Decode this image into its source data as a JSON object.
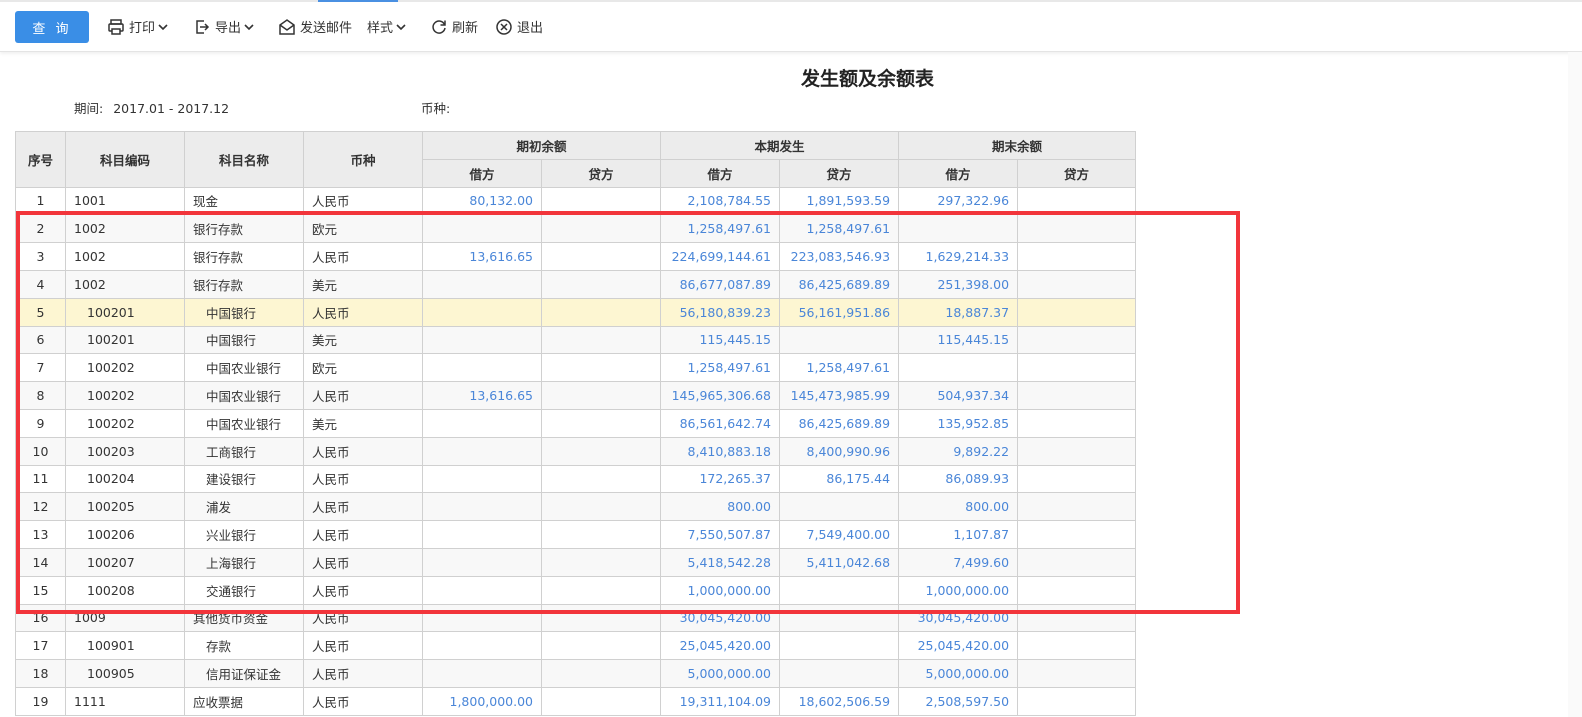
{
  "toolbar": {
    "query": "查 询",
    "print": "打印",
    "export": "导出",
    "email": "发送邮件",
    "style": "样式",
    "refresh": "刷新",
    "exit": "退出"
  },
  "report": {
    "title": "发生额及余额表",
    "period_label": "期间:",
    "period_value": "2017.01 - 2017.12",
    "currency_label": "币种:"
  },
  "table": {
    "headers": {
      "seq": "序号",
      "code": "科目编码",
      "name": "科目名称",
      "currency": "币种",
      "opening": "期初余额",
      "current": "本期发生",
      "closing": "期末余额",
      "debit": "借方",
      "credit": "贷方"
    },
    "rows": [
      {
        "seq": "1",
        "code": "1001",
        "name": "现金",
        "cur": "人民币",
        "ob_d": "80,132.00",
        "ob_c": "",
        "cp_d": "2,108,784.55",
        "cp_c": "1,891,593.59",
        "cb_d": "297,322.96",
        "cb_c": "",
        "indent": 0
      },
      {
        "seq": "2",
        "code": "1002",
        "name": "银行存款",
        "cur": "欧元",
        "ob_d": "",
        "ob_c": "",
        "cp_d": "1,258,497.61",
        "cp_c": "1,258,497.61",
        "cb_d": "",
        "cb_c": "",
        "indent": 0
      },
      {
        "seq": "3",
        "code": "1002",
        "name": "银行存款",
        "cur": "人民币",
        "ob_d": "13,616.65",
        "ob_c": "",
        "cp_d": "224,699,144.61",
        "cp_c": "223,083,546.93",
        "cb_d": "1,629,214.33",
        "cb_c": "",
        "indent": 0
      },
      {
        "seq": "4",
        "code": "1002",
        "name": "银行存款",
        "cur": "美元",
        "ob_d": "",
        "ob_c": "",
        "cp_d": "86,677,087.89",
        "cp_c": "86,425,689.89",
        "cb_d": "251,398.00",
        "cb_c": "",
        "indent": 0
      },
      {
        "seq": "5",
        "code": "100201",
        "name": "中国银行",
        "cur": "人民币",
        "ob_d": "",
        "ob_c": "",
        "cp_d": "56,180,839.23",
        "cp_c": "56,161,951.86",
        "cb_d": "18,887.37",
        "cb_c": "",
        "indent": 1,
        "highlight": true
      },
      {
        "seq": "6",
        "code": "100201",
        "name": "中国银行",
        "cur": "美元",
        "ob_d": "",
        "ob_c": "",
        "cp_d": "115,445.15",
        "cp_c": "",
        "cb_d": "115,445.15",
        "cb_c": "",
        "indent": 1
      },
      {
        "seq": "7",
        "code": "100202",
        "name": "中国农业银行",
        "cur": "欧元",
        "ob_d": "",
        "ob_c": "",
        "cp_d": "1,258,497.61",
        "cp_c": "1,258,497.61",
        "cb_d": "",
        "cb_c": "",
        "indent": 1
      },
      {
        "seq": "8",
        "code": "100202",
        "name": "中国农业银行",
        "cur": "人民币",
        "ob_d": "13,616.65",
        "ob_c": "",
        "cp_d": "145,965,306.68",
        "cp_c": "145,473,985.99",
        "cb_d": "504,937.34",
        "cb_c": "",
        "indent": 1
      },
      {
        "seq": "9",
        "code": "100202",
        "name": "中国农业银行",
        "cur": "美元",
        "ob_d": "",
        "ob_c": "",
        "cp_d": "86,561,642.74",
        "cp_c": "86,425,689.89",
        "cb_d": "135,952.85",
        "cb_c": "",
        "indent": 1
      },
      {
        "seq": "10",
        "code": "100203",
        "name": "工商银行",
        "cur": "人民币",
        "ob_d": "",
        "ob_c": "",
        "cp_d": "8,410,883.18",
        "cp_c": "8,400,990.96",
        "cb_d": "9,892.22",
        "cb_c": "",
        "indent": 1
      },
      {
        "seq": "11",
        "code": "100204",
        "name": "建设银行",
        "cur": "人民币",
        "ob_d": "",
        "ob_c": "",
        "cp_d": "172,265.37",
        "cp_c": "86,175.44",
        "cb_d": "86,089.93",
        "cb_c": "",
        "indent": 1
      },
      {
        "seq": "12",
        "code": "100205",
        "name": "浦发",
        "cur": "人民币",
        "ob_d": "",
        "ob_c": "",
        "cp_d": "800.00",
        "cp_c": "",
        "cb_d": "800.00",
        "cb_c": "",
        "indent": 1
      },
      {
        "seq": "13",
        "code": "100206",
        "name": "兴业银行",
        "cur": "人民币",
        "ob_d": "",
        "ob_c": "",
        "cp_d": "7,550,507.87",
        "cp_c": "7,549,400.00",
        "cb_d": "1,107.87",
        "cb_c": "",
        "indent": 1
      },
      {
        "seq": "14",
        "code": "100207",
        "name": "上海银行",
        "cur": "人民币",
        "ob_d": "",
        "ob_c": "",
        "cp_d": "5,418,542.28",
        "cp_c": "5,411,042.68",
        "cb_d": "7,499.60",
        "cb_c": "",
        "indent": 1
      },
      {
        "seq": "15",
        "code": "100208",
        "name": "交通银行",
        "cur": "人民币",
        "ob_d": "",
        "ob_c": "",
        "cp_d": "1,000,000.00",
        "cp_c": "",
        "cb_d": "1,000,000.00",
        "cb_c": "",
        "indent": 1
      },
      {
        "seq": "16",
        "code": "1009",
        "name": "其他货币资金",
        "cur": "人民币",
        "ob_d": "",
        "ob_c": "",
        "cp_d": "30,045,420.00",
        "cp_c": "",
        "cb_d": "30,045,420.00",
        "cb_c": "",
        "indent": 0
      },
      {
        "seq": "17",
        "code": "100901",
        "name": "存款",
        "cur": "人民币",
        "ob_d": "",
        "ob_c": "",
        "cp_d": "25,045,420.00",
        "cp_c": "",
        "cb_d": "25,045,420.00",
        "cb_c": "",
        "indent": 1
      },
      {
        "seq": "18",
        "code": "100905",
        "name": "信用证保证金",
        "cur": "人民币",
        "ob_d": "",
        "ob_c": "",
        "cp_d": "5,000,000.00",
        "cp_c": "",
        "cb_d": "5,000,000.00",
        "cb_c": "",
        "indent": 1
      },
      {
        "seq": "19",
        "code": "1111",
        "name": "应收票据",
        "cur": "人民币",
        "ob_d": "1,800,000.00",
        "ob_c": "",
        "cp_d": "19,311,104.09",
        "cp_c": "18,602,506.59",
        "cb_d": "2,508,597.50",
        "cb_c": "",
        "indent": 0
      }
    ]
  },
  "colors": {
    "accent": "#3a8ee6",
    "number": "#4a86d8",
    "highlight_row": "#fdf6d2",
    "annotation_box": "#f2353b"
  }
}
